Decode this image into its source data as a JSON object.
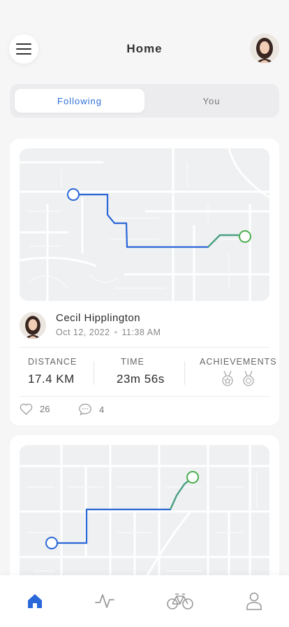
{
  "header": {
    "title": "Home",
    "menu_icon": "hamburger-icon",
    "profile_icon": "avatar"
  },
  "tabs": {
    "items": [
      {
        "label": "Following",
        "active": true
      },
      {
        "label": "You",
        "active": false
      }
    ]
  },
  "activities": [
    {
      "user": {
        "name": "Cecil Hipplington",
        "date": "Oct 12, 2022",
        "time": "11:38 AM"
      },
      "stats": {
        "distance_label": "DISTANCE",
        "distance_value": "17.4 KM",
        "time_label": "TIME",
        "time_value": "23m 56s",
        "achievements_label": "ACHIEVEMENTS",
        "achievement_icons": [
          "medal-icon",
          "medal-icon"
        ]
      },
      "social": {
        "likes": "26",
        "comments": "4"
      }
    },
    {
      "map_only": true
    }
  ],
  "bottom_nav": {
    "items": [
      "home-icon",
      "activity-icon",
      "bike-icon",
      "profile-icon"
    ],
    "active": "home-icon"
  },
  "colors": {
    "accent": "#2f6fd6",
    "route_blue": "#2a67d8",
    "route_green": "#4caf50",
    "background": "#f6f6f7"
  }
}
